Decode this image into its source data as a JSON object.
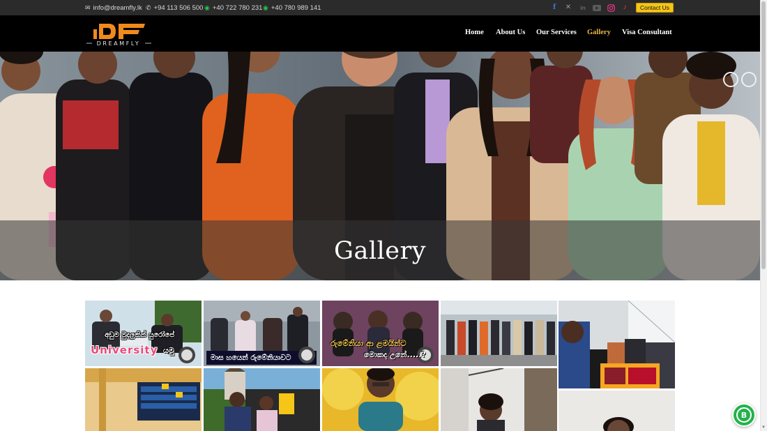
{
  "topbar": {
    "email": "info@dreamfly.lk",
    "phone": "+94 113 506 500",
    "whatsapp_1": "+40 722 780 231",
    "whatsapp_2": "+40 780 989 141",
    "social_icons": [
      "facebook-icon",
      "x-twitter-icon",
      "linkedin-icon",
      "youtube-icon",
      "instagram-icon",
      "tiktok-icon"
    ],
    "contact_button": "Contact Us"
  },
  "brand": {
    "logo_mark": "DF",
    "logo_text": "DREAMFLY"
  },
  "nav": {
    "items": [
      {
        "label": "Home",
        "active": false
      },
      {
        "label": "About Us",
        "active": false
      },
      {
        "label": "Our Services",
        "active": false
      },
      {
        "label": "Gallery",
        "active": true
      },
      {
        "label": "Visa Consultant",
        "active": false
      }
    ]
  },
  "hero": {
    "title": "Gallery"
  },
  "gallery": {
    "tiles": [
      {
        "caption_line1": "අඩුම මුදලකින් යුරෝපේ",
        "caption_line2": "University",
        "caption_line3": "යමු"
      },
      {
        "caption_line1": "මාස හයෙන් රුමේනියාවට"
      },
      {
        "caption_line1": "රුමේනියා ආ ළමයින්ට",
        "caption_line2": "මොකද උනේ.....?"
      },
      {},
      {},
      {},
      {},
      {},
      {},
      {}
    ]
  },
  "colors": {
    "topbar_bg": "#2b2b2b",
    "nav_bg": "#000000",
    "nav_active": "#e8b64a",
    "contact_button_bg": "#f5c518",
    "whatsapp_green": "#23b24c",
    "logo_orange": "#f08a1c"
  }
}
